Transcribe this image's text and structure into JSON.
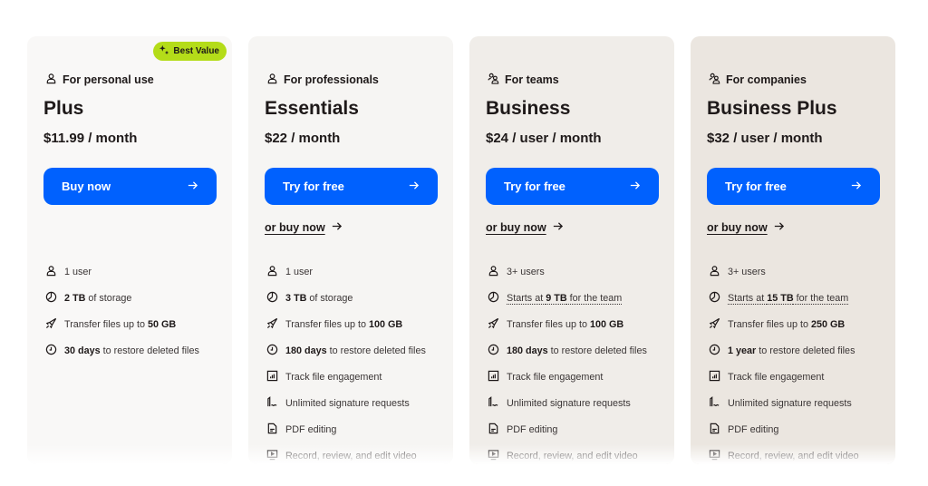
{
  "colors": {
    "accent": "#0061fe",
    "badge": "#b4dc19"
  },
  "plans": [
    {
      "badge": "Best Value",
      "audience": "For personal use",
      "audience_icon": "person-icon",
      "name": "Plus",
      "price": "$11.99 / month",
      "cta": "Buy now",
      "secondary": null,
      "bg": "#f9f8f7",
      "features": [
        {
          "icon": "person-icon",
          "pre": "",
          "bold": "",
          "post": "1 user",
          "dotted": false
        },
        {
          "icon": "storage-icon",
          "pre": "",
          "bold": "2 TB",
          "post": " of storage",
          "dotted": false
        },
        {
          "icon": "send-icon",
          "pre": "Transfer files up to ",
          "bold": "50 GB",
          "post": "",
          "dotted": false
        },
        {
          "icon": "clock-icon",
          "pre": "",
          "bold": "30 days",
          "post": " to restore deleted files",
          "dotted": false
        }
      ]
    },
    {
      "badge": null,
      "audience": "For professionals",
      "audience_icon": "person-icon",
      "name": "Essentials",
      "price": "$22 / month",
      "cta": "Try for free",
      "secondary": "or buy now",
      "bg": "#f6f5f3",
      "features": [
        {
          "icon": "person-icon",
          "pre": "",
          "bold": "",
          "post": "1 user",
          "dotted": false
        },
        {
          "icon": "storage-icon",
          "pre": "",
          "bold": "3 TB",
          "post": " of storage",
          "dotted": false
        },
        {
          "icon": "send-icon",
          "pre": "Transfer files up to ",
          "bold": "100 GB",
          "post": "",
          "dotted": false
        },
        {
          "icon": "clock-icon",
          "pre": "",
          "bold": "180 days",
          "post": " to restore deleted files",
          "dotted": false
        },
        {
          "icon": "chart-icon",
          "pre": "Track file engagement",
          "bold": "",
          "post": "",
          "dotted": false
        },
        {
          "icon": "signature-icon",
          "pre": "Unlimited signature requests",
          "bold": "",
          "post": "",
          "dotted": false
        },
        {
          "icon": "pdf-icon",
          "pre": "PDF editing",
          "bold": "",
          "post": "",
          "dotted": false
        },
        {
          "icon": "video-icon",
          "pre": "Record, review, and edit video",
          "bold": "",
          "post": "",
          "dotted": false
        }
      ]
    },
    {
      "badge": null,
      "audience": "For teams",
      "audience_icon": "people-icon",
      "name": "Business",
      "price": "$24 / user / month",
      "cta": "Try for free",
      "secondary": "or buy now",
      "bg": "#f0ede9",
      "features": [
        {
          "icon": "person-icon",
          "pre": "",
          "bold": "",
          "post": "3+ users",
          "dotted": false
        },
        {
          "icon": "storage-icon",
          "pre": "Starts at ",
          "bold": "9 TB",
          "post": " for the team",
          "dotted": true
        },
        {
          "icon": "send-icon",
          "pre": "Transfer files up to ",
          "bold": "100 GB",
          "post": "",
          "dotted": false
        },
        {
          "icon": "clock-icon",
          "pre": "",
          "bold": "180 days",
          "post": " to restore deleted files",
          "dotted": false
        },
        {
          "icon": "chart-icon",
          "pre": "Track file engagement",
          "bold": "",
          "post": "",
          "dotted": false
        },
        {
          "icon": "signature-icon",
          "pre": "Unlimited signature requests",
          "bold": "",
          "post": "",
          "dotted": false
        },
        {
          "icon": "pdf-icon",
          "pre": "PDF editing",
          "bold": "",
          "post": "",
          "dotted": false
        },
        {
          "icon": "video-icon",
          "pre": "Record, review, and edit video",
          "bold": "",
          "post": "",
          "dotted": false
        }
      ]
    },
    {
      "badge": null,
      "audience": "For companies",
      "audience_icon": "people-icon",
      "name": "Business Plus",
      "price": "$32 / user / month",
      "cta": "Try for free",
      "secondary": "or buy now",
      "bg": "#ebe6e0",
      "features": [
        {
          "icon": "person-icon",
          "pre": "",
          "bold": "",
          "post": "3+ users",
          "dotted": false
        },
        {
          "icon": "storage-icon",
          "pre": "Starts at ",
          "bold": "15 TB",
          "post": " for the team",
          "dotted": true
        },
        {
          "icon": "send-icon",
          "pre": "Transfer files up to ",
          "bold": "250 GB",
          "post": "",
          "dotted": false
        },
        {
          "icon": "clock-icon",
          "pre": "",
          "bold": "1 year",
          "post": " to restore deleted files",
          "dotted": false
        },
        {
          "icon": "chart-icon",
          "pre": "Track file engagement",
          "bold": "",
          "post": "",
          "dotted": false
        },
        {
          "icon": "signature-icon",
          "pre": "Unlimited signature requests",
          "bold": "",
          "post": "",
          "dotted": false
        },
        {
          "icon": "pdf-icon",
          "pre": "PDF editing",
          "bold": "",
          "post": "",
          "dotted": false
        },
        {
          "icon": "video-icon",
          "pre": "Record, review, and edit video",
          "bold": "",
          "post": "",
          "dotted": false
        }
      ]
    }
  ]
}
